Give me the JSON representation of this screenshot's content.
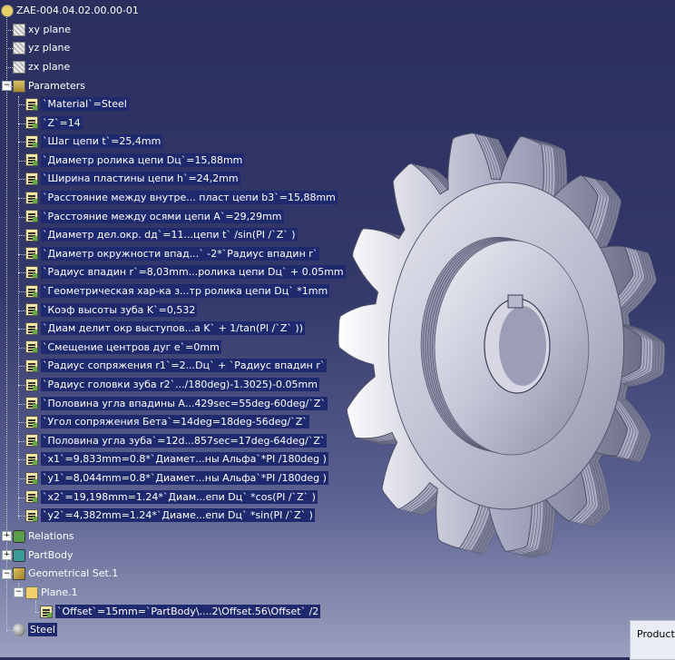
{
  "tree": {
    "root": {
      "label": "ZAE-004.04.02.00.00-01",
      "icon": "part-root-icon"
    },
    "planes": [
      {
        "label": "xy plane",
        "icon": "plane-icon"
      },
      {
        "label": "yz plane",
        "icon": "plane-icon"
      },
      {
        "label": "zx plane",
        "icon": "plane-icon"
      }
    ],
    "parameters": {
      "label": "Parameters",
      "items": [
        "`Material`=Steel",
        "`Z`=14",
        "`Шаг цепи t`=25,4mm",
        "`Диаметр ролика цепи Dц`=15,88mm",
        "`Ширина пластины цепи h`=24,2mm",
        "`Расстояние между внутре... пласт цепи b3`=15,88mm",
        "`Расстояние между осями цепи A`=29,29mm",
        "`Диаметр дел.окр. dд`=11...цепи t` /sin(PI /`Z` )",
        "`Диаметр окружности впад...` -2*`Радиус впадин r`",
        "`Радиус впадин r`=8,03mm...ролика цепи Dц` + 0.05mm",
        "`Геометрическая хар-ка з...тр ролика цепи Dц` *1mm",
        "`Коэф высоты зуба K`=0,532",
        "`Диам делит окр выступов...а K` + 1/tan(PI /`Z` ))",
        "`Смещение центров дуг e`=0mm",
        "`Радиус сопряжения r1`=2...Dц` + `Радиус впадин r`",
        "`Радиус головки зуба r2`.../180deg)-1.3025)-0.05mm",
        "`Половина угла впадины А...429sec=55deg-60deg/`Z`",
        "`Угол сопряжения Бета`=14deg=18deg-56deg/`Z`",
        "`Половина угла зуба`=12d...857sec=17deg-64deg/`Z`",
        "`x1`=9,833mm=0.8*`Диамет...ны Альфа`*PI /180deg )",
        "`y1`=8,044mm=0.8*`Диамет...ны Альфа`*PI /180deg )",
        "`x2`=19,198mm=1.24*`Диам...епи Dц` *cos(PI /`Z` )",
        "`y2`=4,382mm=1.24*`Диаме...епи Dц` *sin(PI /`Z` )"
      ]
    },
    "relations": "Relations",
    "partbody": "PartBody",
    "geoset": "Geometrical Set.1",
    "plane1": "Plane.1",
    "offset": "`Offset`=15mm=`PartBody\\....2\\Offset.56\\Offset` /2",
    "material": "Steel"
  },
  "product_panel": {
    "title": "Product"
  },
  "colors": {
    "background_top": "#2a2f5e",
    "background_bottom": "#9ba0bf",
    "sprocket": "#cfd0de",
    "selection": "#1f2a6e"
  }
}
